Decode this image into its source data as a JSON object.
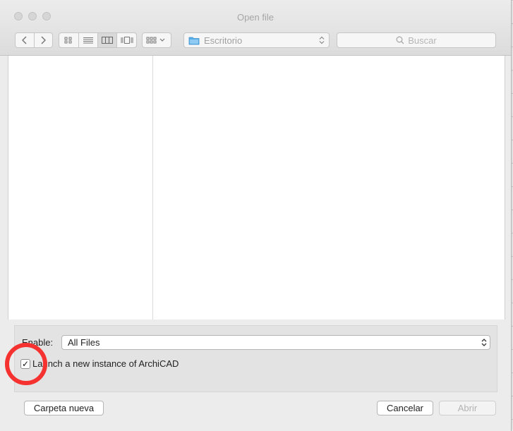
{
  "window": {
    "title": "Open file"
  },
  "toolbar": {
    "location": "Escritorio",
    "search_placeholder": "Buscar"
  },
  "filter": {
    "label": "Enable:",
    "selected": "All Files"
  },
  "options": {
    "launch_label": "Launch a new instance of ArchiCAD",
    "launch_checked": true,
    "check_mark": "✓"
  },
  "buttons": {
    "new_folder": "Carpeta nueva",
    "cancel": "Cancelar",
    "open": "Abrir"
  },
  "colors": {
    "highlight_circle": "#f5322f",
    "folder_icon": "#5aaee8"
  }
}
